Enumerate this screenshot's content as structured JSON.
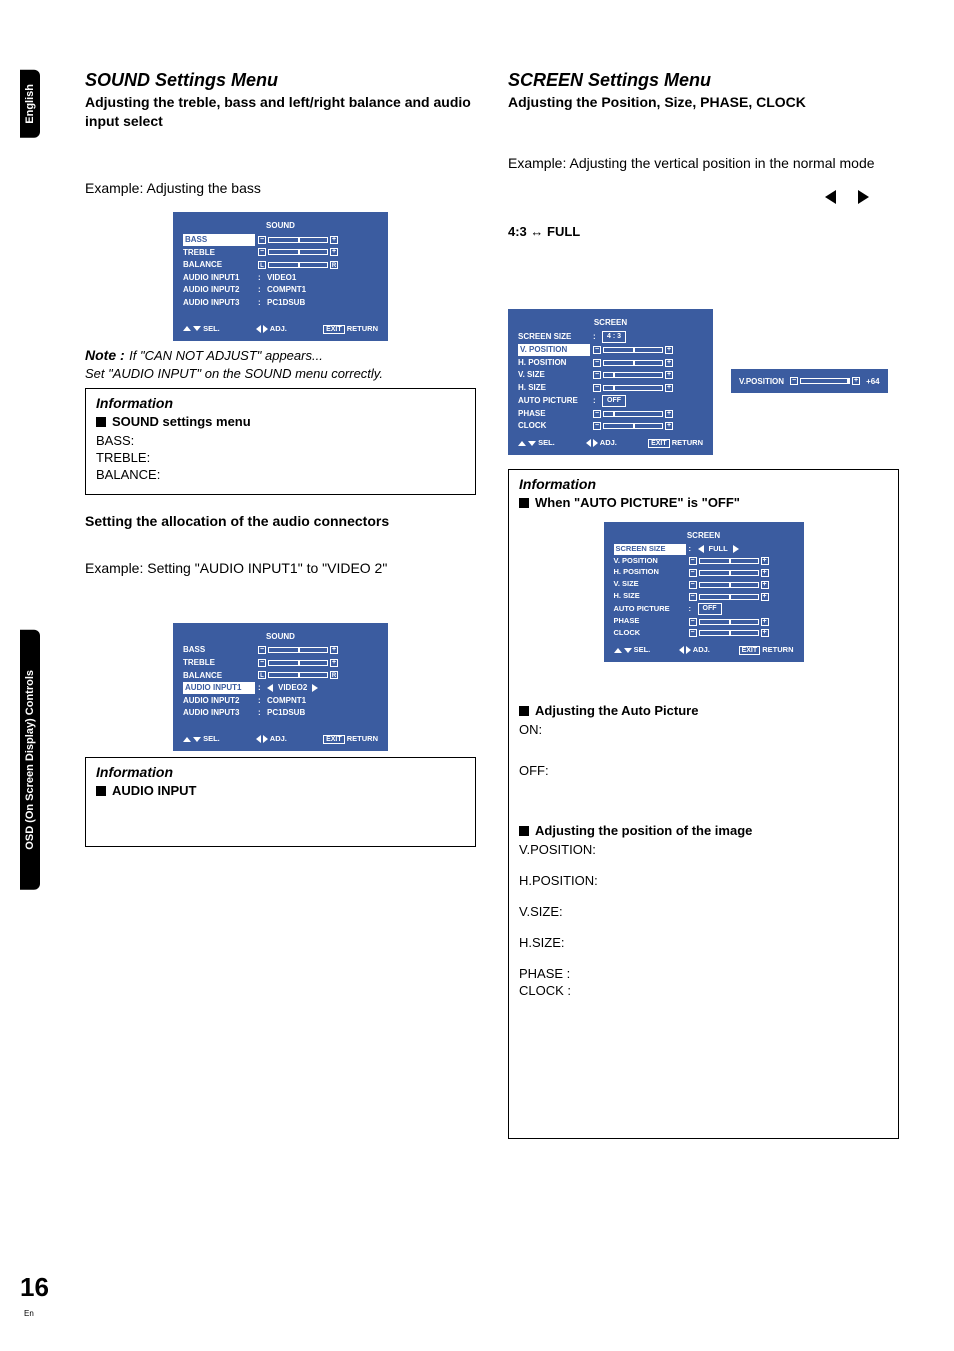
{
  "sideTabs": {
    "english": "English",
    "osd": "OSD (On Screen Display) Controls"
  },
  "left": {
    "h1": "SOUND Settings Menu",
    "sub": "Adjusting the treble, bass and left/right balance and audio input select",
    "ex1": "Example: Adjusting the bass",
    "osd1": {
      "title": "SOUND",
      "rows": {
        "bass": "BASS",
        "treble": "TREBLE",
        "balance": "BALANCE",
        "ai1": "AUDIO INPUT1",
        "ai2": "AUDIO INPUT2",
        "ai3": "AUDIO INPUT3",
        "v1": "VIDEO1",
        "c1": "COMPNT1",
        "pc": "PC1DSUB"
      },
      "footer": {
        "sel": "SEL.",
        "adj": "ADJ.",
        "exit": "EXIT",
        "ret": "RETURN"
      }
    },
    "noteLabel": "Note :",
    "noteBody1": "If \"CAN NOT ADJUST\" appears...",
    "noteBody2": "Set \"AUDIO INPUT\" on the SOUND menu correctly.",
    "info1": {
      "title": "Information",
      "sub": "SOUND settings menu",
      "l1": "BASS:",
      "l2": "TREBLE:",
      "l3": "BALANCE:"
    },
    "sect2": "Setting the allocation of the audio connectors",
    "ex2": "Example: Setting \"AUDIO INPUT1\" to \"VIDEO 2\"",
    "osd2": {
      "title": "SOUND",
      "v2": "VIDEO2"
    },
    "info2": {
      "title": "Information",
      "sub": "AUDIO INPUT"
    }
  },
  "right": {
    "h1": "SCREEN Settings Menu",
    "sub": "Adjusting the Position, Size, PHASE, CLOCK",
    "ex1": "Example: Adjusting the vertical position in the normal mode",
    "aspect": "4:3 ↔ FULL",
    "osd1": {
      "title": "SCREEN",
      "rows": {
        "ss": "SCREEN SIZE",
        "vp": "V. POSITION",
        "hp": "H. POSITION",
        "vs": "V. SIZE",
        "hs": "H. SIZE",
        "ap": "AUTO PICTURE",
        "ph": "PHASE",
        "cl": "CLOCK",
        "ssv": "4 : 3",
        "apv": "OFF"
      },
      "footer": {
        "sel": "SEL.",
        "adj": "ADJ.",
        "exit": "EXIT",
        "ret": "RETURN"
      }
    },
    "osd1b": {
      "label": "V.POSITION",
      "val": "+64"
    },
    "info1": {
      "title": "Information",
      "sub": "When \"AUTO PICTURE\" is \"OFF\"",
      "osd": {
        "title": "SCREEN",
        "full": "FULL",
        "off": "OFF"
      },
      "ap_h": "Adjusting the Auto Picture",
      "on": "ON:",
      "off": "OFF:",
      "pos_h": "Adjusting the position of the image",
      "vp": "V.POSITION:",
      "hp": "H.POSITION:",
      "vs": "V.SIZE:",
      "hs": "H.SIZE:",
      "ph": "PHASE :",
      "cl": "CLOCK :"
    }
  },
  "page": {
    "num": "16",
    "en": "En"
  }
}
